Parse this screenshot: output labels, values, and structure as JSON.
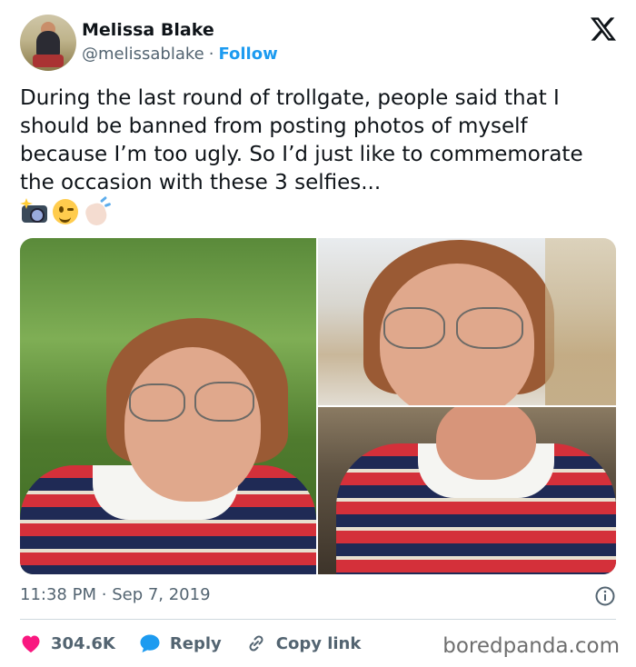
{
  "author": {
    "name": "Melissa Blake",
    "handle": "@melissablake",
    "separator": "·",
    "follow_label": "Follow"
  },
  "tweet": {
    "text": "During the last round of trollgate, people said that I should be banned from posting photos of myself because I’m too ugly. So I’d just like to commemorate the occasion with these 3 selfies...",
    "emojis": [
      "camera-with-flash-icon",
      "winking-face-icon",
      "waving-hand-icon"
    ]
  },
  "media": {
    "photos": [
      "selfie-park",
      "selfie-building",
      "selfie-indoor"
    ]
  },
  "meta": {
    "time": "11:38 PM",
    "separator": "·",
    "date": "Sep 7, 2019"
  },
  "actions": {
    "likes": "304.6K",
    "reply_label": "Reply",
    "copy_label": "Copy link"
  },
  "watermark": "boredpanda.com",
  "colors": {
    "follow": "#1d9bf0",
    "like_heart": "#f91880",
    "reply_bubble": "#1d9bf0",
    "secondary_text": "#536471"
  }
}
